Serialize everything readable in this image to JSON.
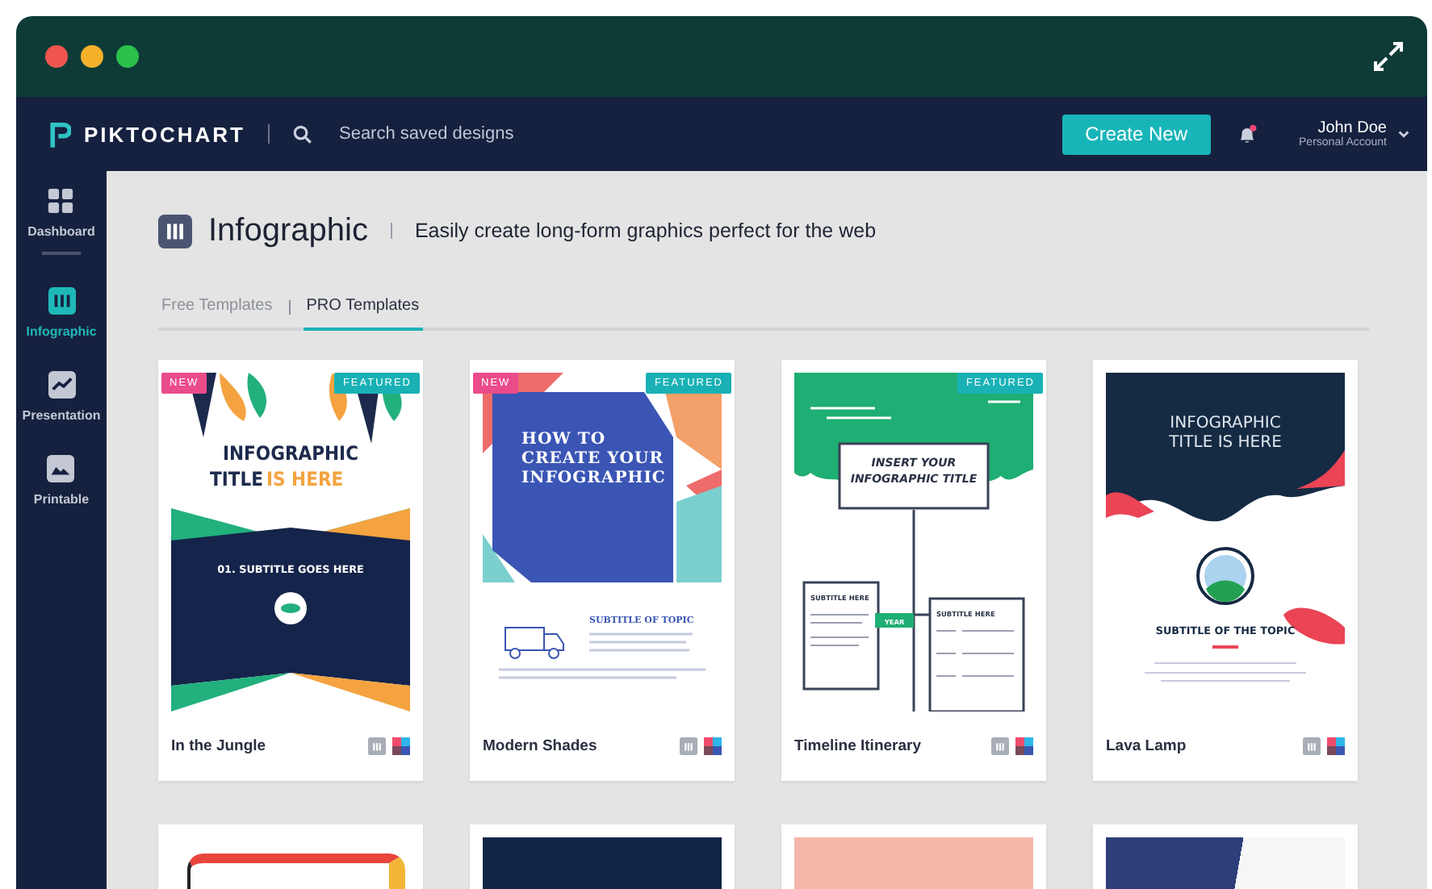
{
  "navbar": {
    "brand": "PIKTOCHART",
    "search": {
      "placeholder": "Search saved designs"
    },
    "create_button": "Create New",
    "notifications": {
      "unread": true
    },
    "user": {
      "name": "John Doe",
      "account": "Personal Account"
    }
  },
  "sidebar": {
    "items": [
      {
        "kind": "dashboard",
        "label": "Dashboard",
        "selected": false
      },
      {
        "kind": "infographic",
        "label": "Infographic",
        "selected": true
      },
      {
        "kind": "presentation",
        "label": "Presentation",
        "selected": false
      },
      {
        "kind": "printable",
        "label": "Printable",
        "selected": false
      }
    ]
  },
  "header": {
    "title": "Infographic",
    "tagline": "Easily create long-form graphics perfect for the web"
  },
  "tabs": [
    {
      "label": "Free Templates",
      "selected": false
    },
    {
      "label": "PRO Templates",
      "selected": true
    }
  ],
  "templates": [
    {
      "name": "In the Jungle",
      "kind": "jungle",
      "badges": [
        {
          "kind": "new",
          "label": "NEW"
        },
        {
          "kind": "featured",
          "label": "FEATURED"
        }
      ],
      "preview": [
        "INFOGRAPHIC",
        "TITLE",
        "IS HERE",
        "01. SUBTITLE GOES HERE"
      ]
    },
    {
      "name": "Modern Shades",
      "kind": "shades",
      "badges": [
        {
          "kind": "new",
          "label": "NEW"
        },
        {
          "kind": "featured",
          "label": "FEATURED"
        }
      ],
      "preview": [
        "HOW TO",
        "CREATE YOUR",
        "INFOGRAPHIC",
        "SUBTITLE OF TOPIC"
      ]
    },
    {
      "name": "Timeline Itinerary",
      "kind": "timeline",
      "badges": [
        {
          "kind": "featured",
          "label": "FEATURED"
        }
      ],
      "preview": [
        "INSERT YOUR",
        "INFOGRAPHIC TITLE",
        "SUBTITLE HERE",
        "YEAR",
        "SUBTITLE HERE"
      ]
    },
    {
      "name": "Lava Lamp",
      "kind": "lava",
      "preview": [
        "INFOGRAPHIC",
        "TITLE IS HERE",
        "SUBTITLE OF THE TOPIC"
      ]
    }
  ],
  "more_templates": [
    {
      "kind": "frame"
    },
    {
      "kind": "navy"
    },
    {
      "kind": "peach"
    },
    {
      "kind": "photo"
    }
  ]
}
